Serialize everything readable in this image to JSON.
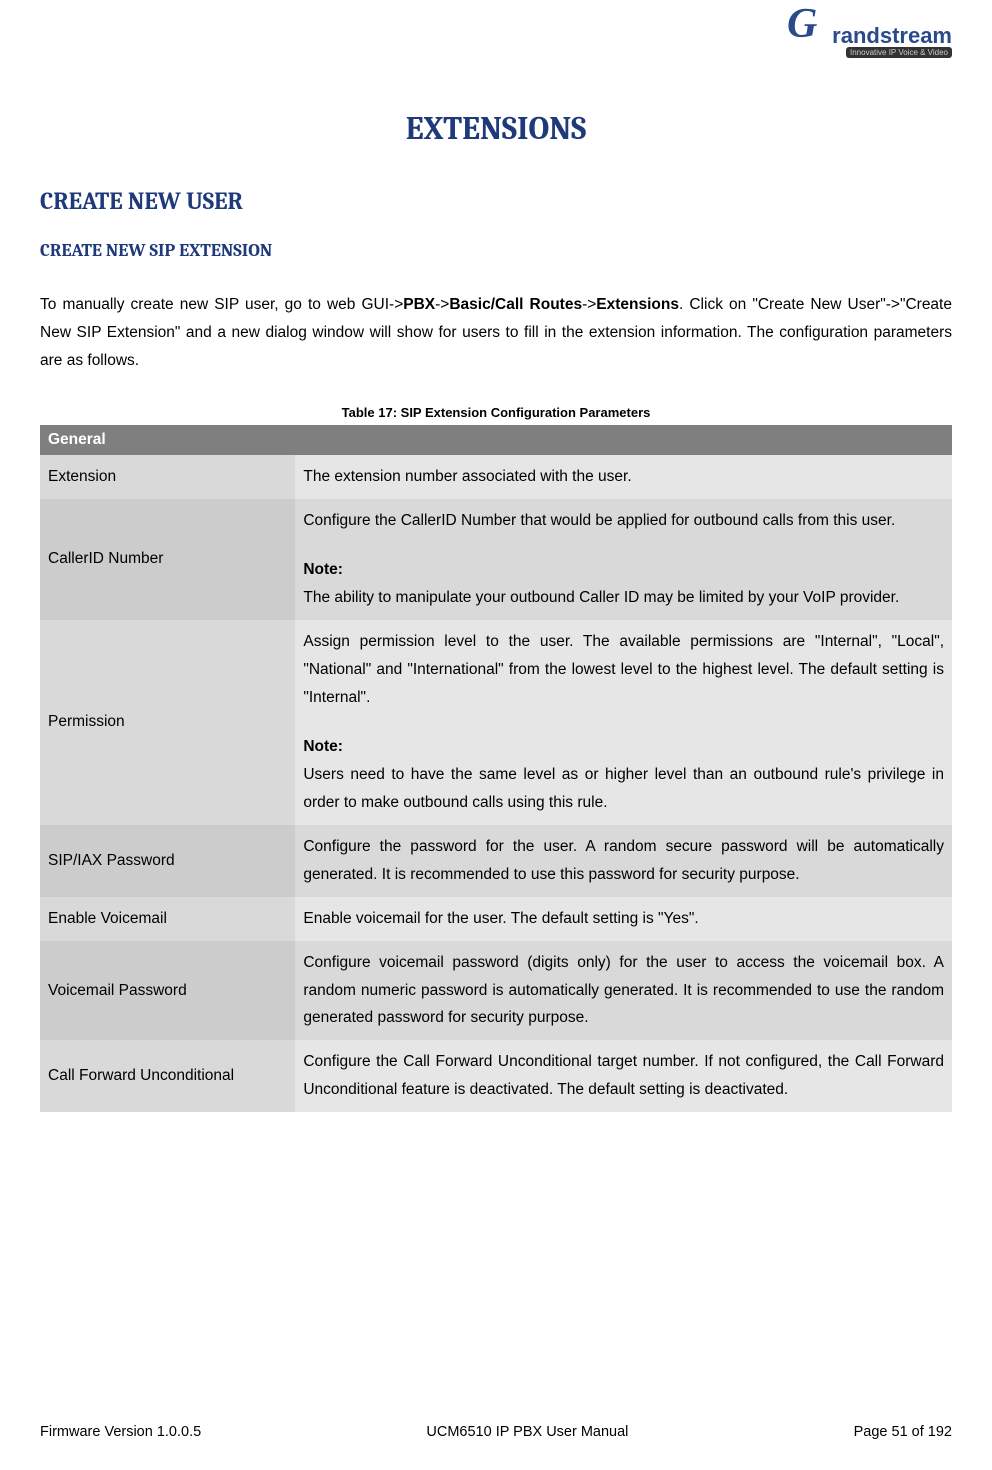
{
  "logo": {
    "symbol": "G",
    "brand": "randstream",
    "tagline": "Innovative IP Voice & Video"
  },
  "page_title": "EXTENSIONS",
  "section1_heading": "CREATE NEW USER",
  "section2_heading": "CREATE NEW SIP EXTENSION",
  "intro": {
    "pre": "To manually create new SIP user, go to web GUI->",
    "b1": "PBX",
    "sep1": "->",
    "b2": "Basic/Call Routes",
    "sep2": "->",
    "b3": "Extensions",
    "post": ". Click on \"Create New User\"->\"Create New SIP Extension\" and a new dialog window will show for users to fill in the extension information. The configuration parameters are as follows."
  },
  "table_caption": "Table 17: SIP Extension Configuration Parameters",
  "table": {
    "section_header": "General",
    "rows": [
      {
        "label": "Extension",
        "desc": "The extension number associated with the user."
      },
      {
        "label": "CallerID Number",
        "desc": "Configure the CallerID Number that would be applied for outbound calls from this user.",
        "note_label": "Note:",
        "note": "The ability to manipulate your outbound Caller ID may be limited by your VoIP provider."
      },
      {
        "label": "Permission",
        "desc": "Assign permission level to the user. The available permissions are \"Internal\", \"Local\", \"National\" and \"International\" from the lowest level to the highest level. The default setting is \"Internal\".",
        "note_label": "Note:",
        "note": "Users need to have the same level as or higher level than an outbound rule's privilege in order to make outbound calls using this rule."
      },
      {
        "label": "SIP/IAX Password",
        "desc": "Configure the password for the user. A random secure password will be automatically generated. It is recommended to use this password for security purpose."
      },
      {
        "label": "Enable Voicemail",
        "desc": "Enable voicemail for the user. The default setting is \"Yes\"."
      },
      {
        "label": "Voicemail Password",
        "desc": "Configure voicemail password (digits only) for the user to access the voicemail box. A random numeric password is automatically generated. It is recommended to use the random generated password for security purpose."
      },
      {
        "label": "Call Forward Unconditional",
        "desc": "Configure the Call Forward Unconditional target number. If not configured, the Call Forward Unconditional feature is deactivated. The default setting is deactivated."
      }
    ]
  },
  "footer": {
    "left": "Firmware Version 1.0.0.5",
    "center": "UCM6510 IP PBX User Manual",
    "right": "Page 51 of 192"
  }
}
